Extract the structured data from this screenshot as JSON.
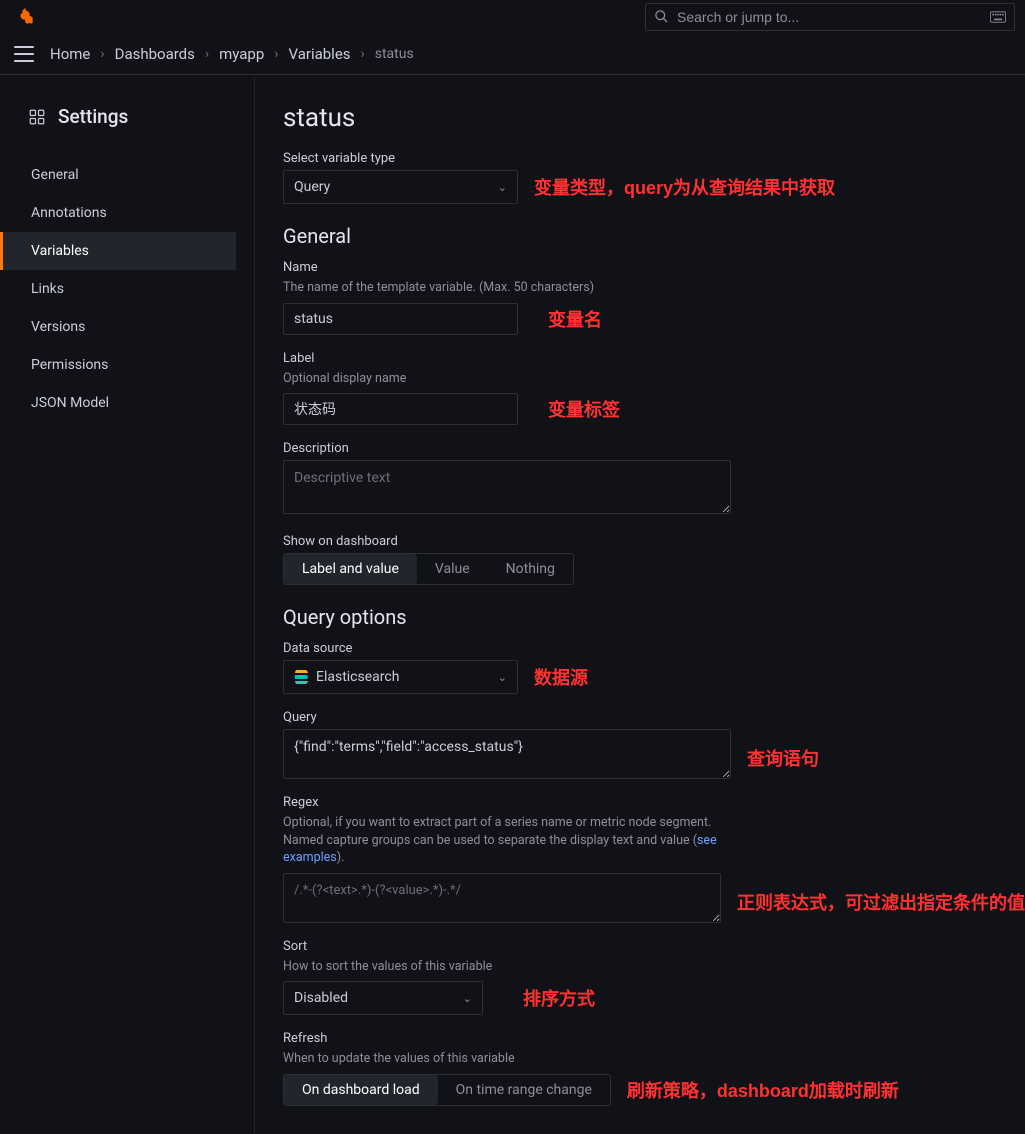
{
  "search": {
    "placeholder": "Search or jump to..."
  },
  "breadcrumbs": {
    "home": "Home",
    "dashboards": "Dashboards",
    "app": "myapp",
    "variables": "Variables",
    "current": "status"
  },
  "sidebar": {
    "title": "Settings",
    "items": [
      {
        "label": "General"
      },
      {
        "label": "Annotations"
      },
      {
        "label": "Variables"
      },
      {
        "label": "Links"
      },
      {
        "label": "Versions"
      },
      {
        "label": "Permissions"
      },
      {
        "label": "JSON Model"
      }
    ]
  },
  "page": {
    "title": "status"
  },
  "varType": {
    "label": "Select variable type",
    "value": "Query"
  },
  "sections": {
    "general": "General",
    "queryOptions": "Query options"
  },
  "name": {
    "label": "Name",
    "hint": "The name of the template variable. (Max. 50 characters)",
    "value": "status"
  },
  "labelField": {
    "label": "Label",
    "hint": "Optional display name",
    "value": "状态码"
  },
  "description": {
    "label": "Description",
    "placeholder": "Descriptive text",
    "value": ""
  },
  "showOn": {
    "label": "Show on dashboard",
    "opts": [
      "Label and value",
      "Value",
      "Nothing"
    ],
    "selected": 0
  },
  "dataSource": {
    "label": "Data source",
    "value": "Elasticsearch"
  },
  "query": {
    "label": "Query",
    "value": "{\"find\":\"terms\",\"field\":\"access_status\"}"
  },
  "regex": {
    "label": "Regex",
    "hint1": "Optional, if you want to extract part of a series name or metric node segment.",
    "hint2a": "Named capture groups can be used to separate the display text and value (",
    "hint2link": "see examples",
    "hint2b": ").",
    "placeholder": "/.*-(?<text>.*)-(?<value>.*)-.*/",
    "value": ""
  },
  "sort": {
    "label": "Sort",
    "hint": "How to sort the values of this variable",
    "value": "Disabled"
  },
  "refresh": {
    "label": "Refresh",
    "hint": "When to update the values of this variable",
    "opts": [
      "On dashboard load",
      "On time range change"
    ],
    "selected": 0
  },
  "annotations": {
    "varType": "变量类型，query为从查询结果中获取",
    "name": "变量名",
    "label": "变量标签",
    "dataSource": "数据源",
    "query": "查询语句",
    "regex": "正则表达式，可过滤出指定条件的值",
    "sort": "排序方式",
    "refresh": "刷新策略，dashboard加载时刷新"
  }
}
